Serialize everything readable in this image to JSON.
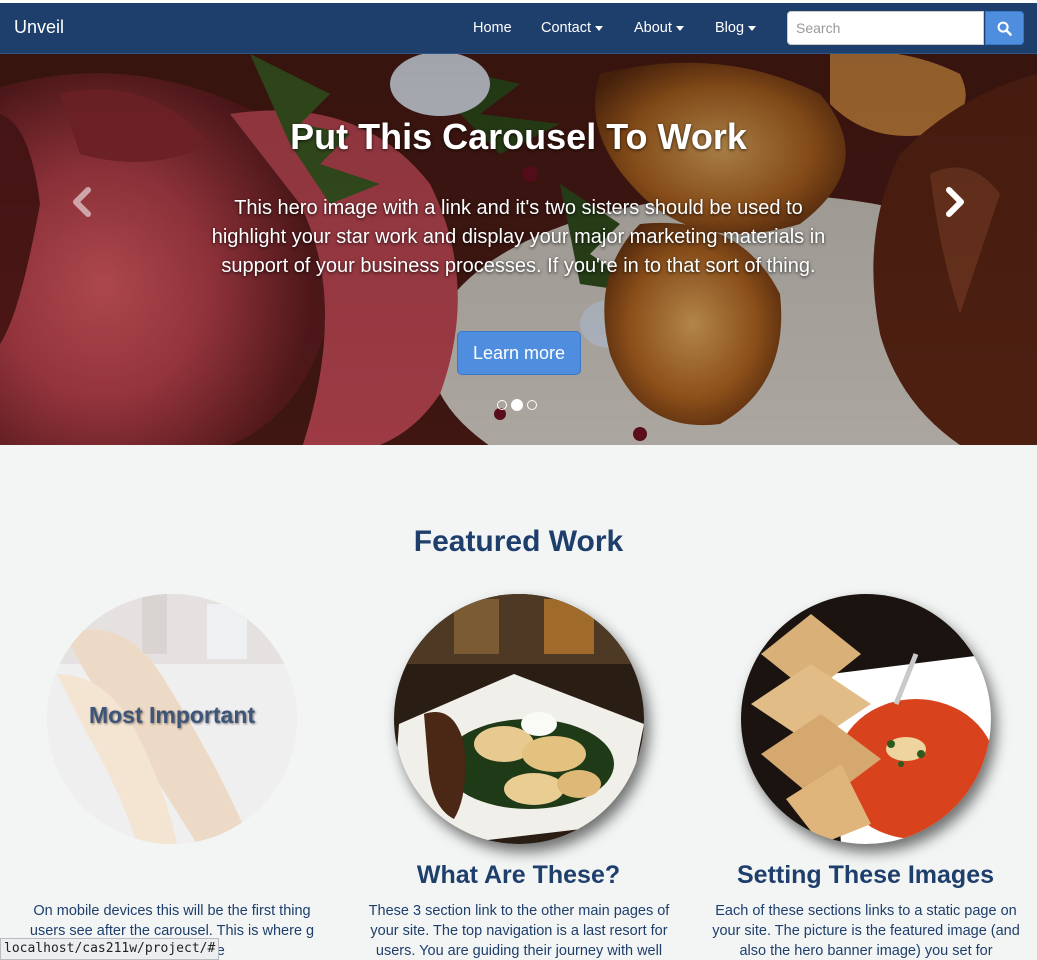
{
  "navbar": {
    "brand": "Unveil",
    "items": [
      {
        "label": "Home",
        "dropdown": false
      },
      {
        "label": "Contact",
        "dropdown": true
      },
      {
        "label": "About",
        "dropdown": true
      },
      {
        "label": "Blog",
        "dropdown": true
      }
    ],
    "search_placeholder": "Search",
    "search_icon": "search-icon"
  },
  "carousel": {
    "title": "Put This Carousel To Work",
    "text": "This hero image with a link and it's two sisters should be used to highlight your star work and display your major marketing materials in support of your business processes. If you're in to that sort of thing.",
    "button": "Learn more",
    "prev_icon": "chevron-left-icon",
    "next_icon": "chevron-right-icon",
    "slide_count": 3,
    "active_slide": 2
  },
  "featured": {
    "title": "Featured Work",
    "columns": [
      {
        "image_label": "Most Important",
        "title": "",
        "text": "On mobile devices this will be the first thing users see after the carousel. This is where g should go. Gaze"
      },
      {
        "title": "What Are These?",
        "text": "These 3 section link to the other main pages of your site. The top navigation is a last resort for users. You are guiding their journey with well"
      },
      {
        "title": "Setting These Images",
        "text": "Each of these sections links to a static page on your site. The picture is the featured image (and also the hero banner image) you set for"
      }
    ]
  },
  "status_bar": {
    "url": "localhost/cas211w/project/#"
  },
  "colors": {
    "navbar": "#1e3e6c",
    "accent": "#4f8ede",
    "heading": "#1e3e6c",
    "background": "#f3f5f5"
  }
}
